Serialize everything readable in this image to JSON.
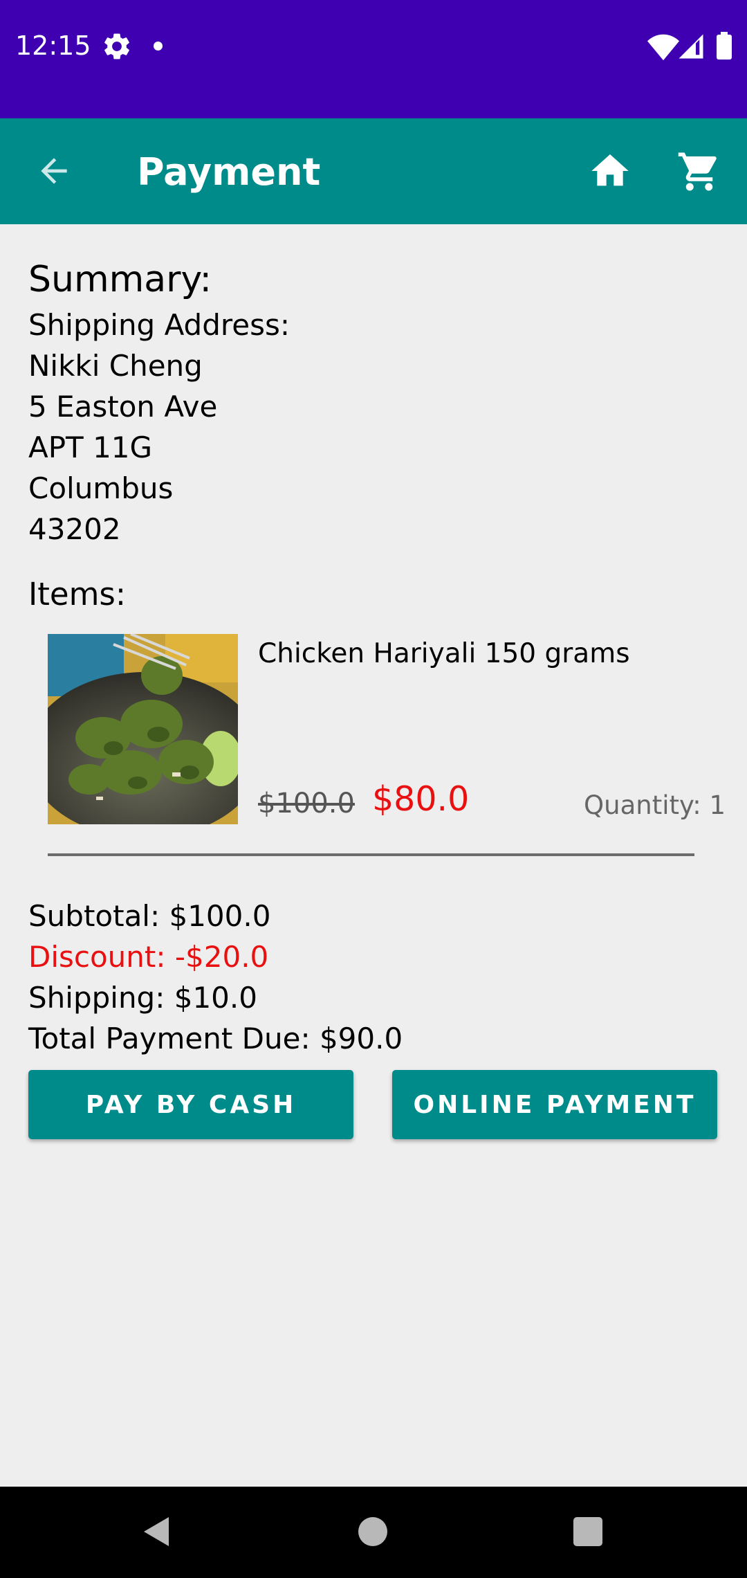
{
  "status_bar": {
    "time": "12:15"
  },
  "app_bar": {
    "title": "Payment"
  },
  "summary": {
    "title": "Summary:",
    "shipping_label": "Shipping Address:",
    "address_lines": [
      "Nikki Cheng",
      "5 Easton Ave",
      "APT 11G",
      "Columbus",
      "43202"
    ]
  },
  "items": {
    "title": "Items:",
    "list": [
      {
        "name": "Chicken Hariyali 150 grams",
        "original_price": "$100.0",
        "price": "$80.0",
        "quantity": "Quantity: 1"
      }
    ]
  },
  "totals": {
    "subtotal": "Subtotal: $100.0",
    "discount": "Discount: -$20.0",
    "shipping": "Shipping: $10.0",
    "total": "Total Payment Due: $90.0"
  },
  "buttons": {
    "cash": "PAY BY CASH",
    "online": "ONLINE PAYMENT"
  },
  "colors": {
    "status_bar": "#3f00b2",
    "app_bar": "#008b8b",
    "button": "#008b8b",
    "discount": "#e81010",
    "background": "#eeeeee"
  }
}
